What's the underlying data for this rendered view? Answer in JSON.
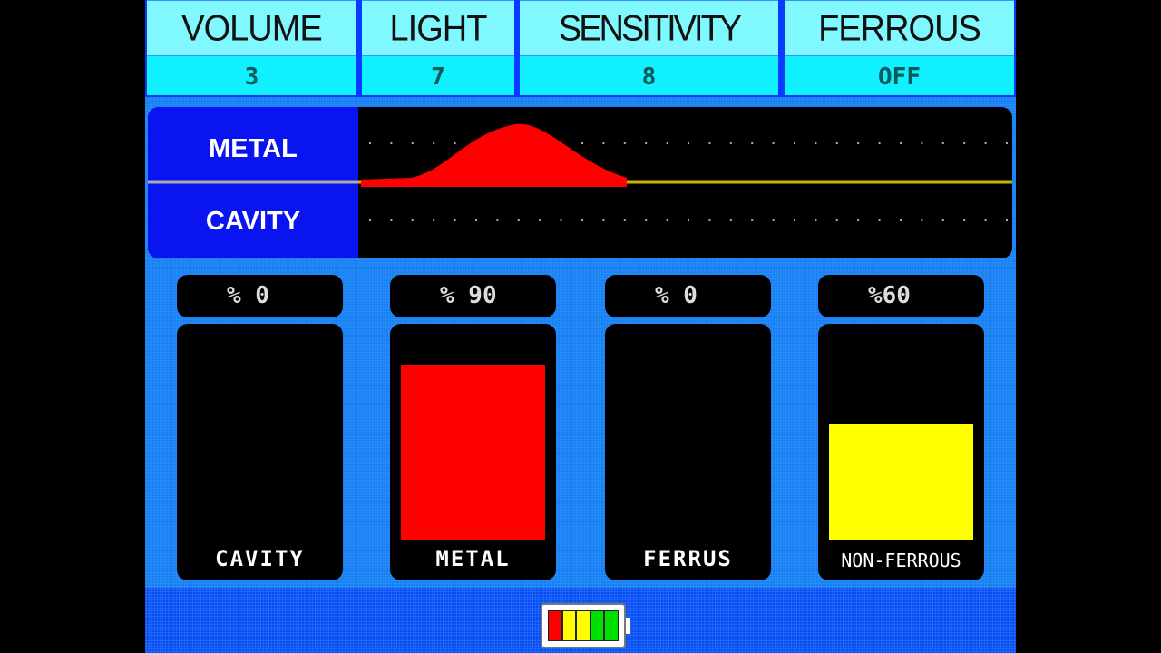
{
  "header": [
    {
      "label": "VOLUME",
      "value": "3"
    },
    {
      "label": "LIGHT",
      "value": "7"
    },
    {
      "label": "SENSITIVITY",
      "value": "8"
    },
    {
      "label": "FERROUS",
      "value": "OFF"
    }
  ],
  "signal_graph": {
    "top_label": "METAL",
    "bottom_label": "CAVITY",
    "signal_color": "#ff0000",
    "baseline_color": "#c8b400"
  },
  "meters": [
    {
      "percent_text": "% 0",
      "value": 0,
      "label": "CAVITY",
      "color": "#ff0000"
    },
    {
      "percent_text": "% 90",
      "value": 90,
      "label": "METAL",
      "color": "#ff0000"
    },
    {
      "percent_text": "% 0",
      "value": 0,
      "label": "FERRUS",
      "color": "#ff0000"
    },
    {
      "percent_text": "%60",
      "value": 60,
      "label": "NON-FERROUS",
      "color": "#ffff00"
    }
  ],
  "battery": {
    "icon": "battery-icon",
    "segments": [
      "#ff0000",
      "#ffff00",
      "#ffff00",
      "#00e000",
      "#00e000"
    ]
  }
}
